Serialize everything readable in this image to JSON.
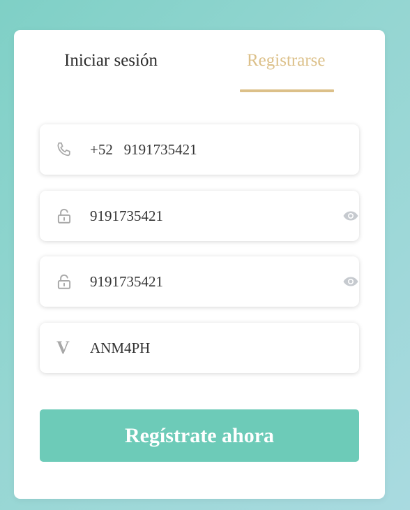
{
  "tabs": {
    "login_label": "Iniciar sesión",
    "register_label": "Registrarse",
    "active": "register"
  },
  "form": {
    "phone": {
      "country_code": "+52",
      "number": "9191735421",
      "display": "+52   9191735421",
      "icon": "phone-icon"
    },
    "password": {
      "value": "9191735421",
      "icon": "lock-icon",
      "toggle_icon": "eye-icon"
    },
    "confirm_password": {
      "value": "9191735421",
      "icon": "lock-icon",
      "toggle_icon": "eye-icon"
    },
    "invite_code": {
      "value": "ANM4PH",
      "icon_glyph": "V"
    },
    "submit_label": "Regístrate ahora"
  },
  "colors": {
    "accent_gold": "#dcc089",
    "button_teal": "#6dcbb8",
    "icon_gray": "#a8a8a8"
  }
}
